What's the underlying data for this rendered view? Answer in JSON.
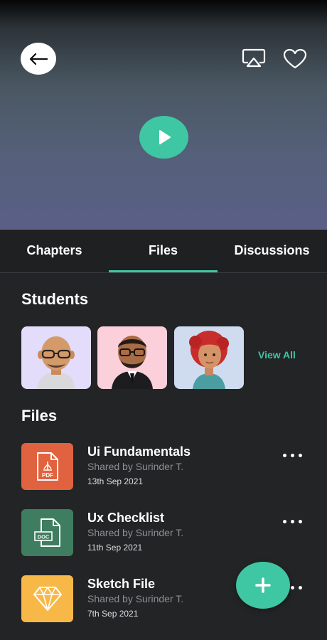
{
  "player": {
    "icons": {
      "back": "arrow-left-icon",
      "cast": "airplay-icon",
      "favorite": "heart-icon",
      "play": "play-icon"
    }
  },
  "tabs": [
    {
      "label": "Chapters",
      "active": false
    },
    {
      "label": "Files",
      "active": true
    },
    {
      "label": "Discussions",
      "active": false
    }
  ],
  "students": {
    "title": "Students",
    "view_all": "View All",
    "avatars": [
      "avatar-1",
      "avatar-2",
      "avatar-3"
    ]
  },
  "files": {
    "title": "Files",
    "items": [
      {
        "name": "Ui Fundamentals",
        "shared_by": "Shared by Surinder T.",
        "date": "13th Sep 2021",
        "type": "PDF",
        "color": "#e0623f"
      },
      {
        "name": "Ux Checklist",
        "shared_by": "Shared by Surinder T.",
        "date": "11th Sep 2021",
        "type": "DOC",
        "color": "#3f7d60"
      },
      {
        "name": "Sketch File",
        "shared_by": "Shared by Surinder T.",
        "date": "7th Sep 2021",
        "type": "sketch",
        "color": "#f8b847"
      }
    ]
  },
  "colors": {
    "accent": "#3ec7a2",
    "background": "#232426"
  }
}
